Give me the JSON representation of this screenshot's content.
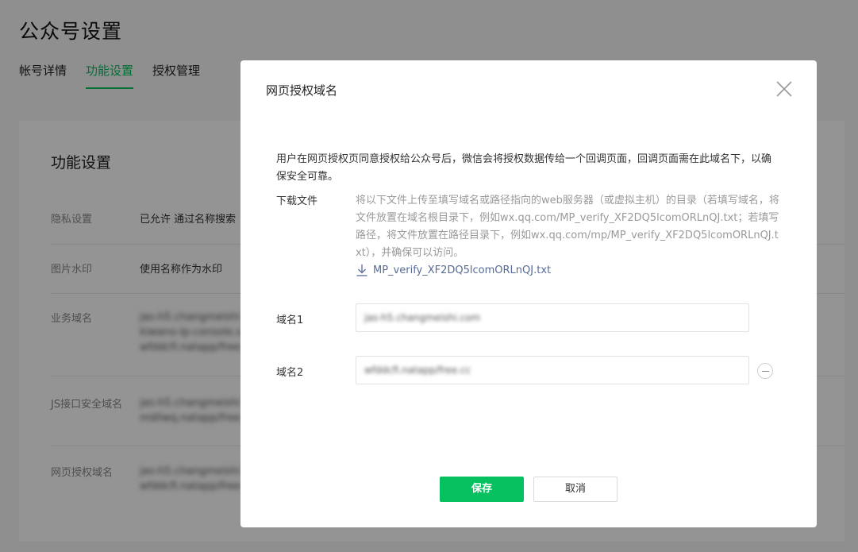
{
  "page": {
    "title": "公众号设置",
    "tabs": [
      {
        "label": "帐号详情"
      },
      {
        "label": "功能设置"
      },
      {
        "label": "授权管理"
      }
    ],
    "section_title": "功能设置",
    "rows": [
      {
        "label": "隐私设置",
        "value": "已允许 通过名称搜索"
      },
      {
        "label": "图片水印",
        "value": "使用名称作为水印"
      },
      {
        "label": "业务域名",
        "value_lines": [
          "jas-h5.changmeishi",
          "kiwano-lp-console.s",
          "wfddcfi.natapp/free"
        ]
      },
      {
        "label": "JS接口安全域名",
        "value_lines": [
          "jas-h5.changmeishi",
          "mdilwq.natapp/free"
        ]
      },
      {
        "label": "网页授权域名",
        "value_lines": [
          "jas-h5.changmeishi",
          "wfddcfi.natapp/free"
        ]
      }
    ]
  },
  "dialog": {
    "title": "网页授权域名",
    "description": "用户在网页授权页同意授权给公众号后，微信会将授权数据传给一个回调页面，回调页面需在此域名下，以确保安全可靠。",
    "download_label": "下载文件",
    "download_text": "将以下文件上传至填写域名或路径指向的web服务器（或虚拟主机）的目录（若填写域名，将文件放置在域名根目录下，例如wx.qq.com/MP_verify_XF2DQ5lcomORLnQJ.txt；若填写路径，将文件放置在路径目录下，例如wx.qq.com/mp/MP_verify_XF2DQ5lcomORLnQJ.txt），并确保可以访问。",
    "download_file": "MP_verify_XF2DQ5lcomORLnQJ.txt",
    "fields": [
      {
        "label": "域名1",
        "value": "jas-h5.changmeishi.com"
      },
      {
        "label": "域名2",
        "value": "wfddcfi.natapp/free.cc"
      }
    ],
    "save_label": "保存",
    "cancel_label": "取消"
  },
  "colors": {
    "accent": "#07c160",
    "link": "#576b95"
  }
}
